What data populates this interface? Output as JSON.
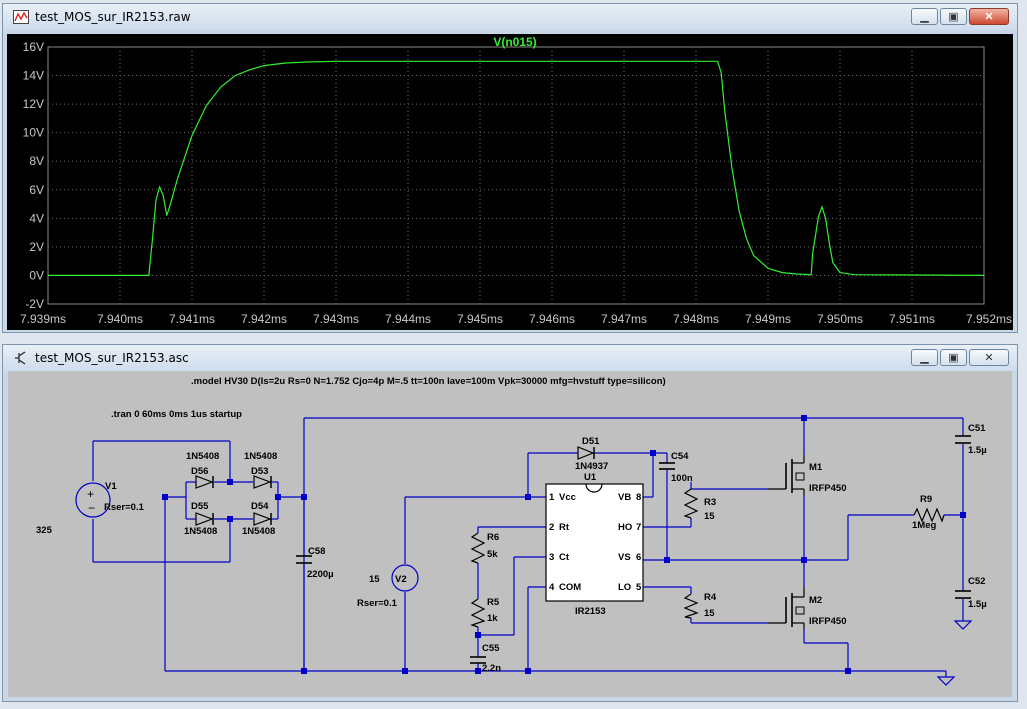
{
  "plot_window": {
    "title": "test_MOS_sur_IR2153.raw"
  },
  "schematic_window": {
    "title": "test_MOS_sur_IR2153.asc"
  },
  "chart_data": {
    "type": "line",
    "title": "V(n015)",
    "x_tick_labels": [
      "7.939ms",
      "7.940ms",
      "7.941ms",
      "7.942ms",
      "7.943ms",
      "7.944ms",
      "7.945ms",
      "7.946ms",
      "7.947ms",
      "7.948ms",
      "7.949ms",
      "7.950ms",
      "7.951ms",
      "7.952ms"
    ],
    "y_tick_labels": [
      "16V",
      "14V",
      "12V",
      "10V",
      "8V",
      "6V",
      "4V",
      "2V",
      "0V",
      "-2V"
    ],
    "xlim": [
      7.939,
      7.952
    ],
    "ylim": [
      -2,
      16
    ],
    "x_unit": "ms",
    "grid": true,
    "series": [
      {
        "name": "V(n015)",
        "color": "#33ee33",
        "x": [
          7.939,
          7.9404,
          7.94045,
          7.9405,
          7.94055,
          7.9406,
          7.94065,
          7.9407,
          7.9408,
          7.941,
          7.9412,
          7.9414,
          7.9416,
          7.9418,
          7.942,
          7.9423,
          7.9426,
          7.943,
          7.948,
          7.9483,
          7.94835,
          7.9484,
          7.9485,
          7.9486,
          7.9487,
          7.9488,
          7.949,
          7.9492,
          7.9494,
          7.9496,
          7.94962,
          7.9497,
          7.94975,
          7.9498,
          7.94985,
          7.9499,
          7.95,
          7.9502,
          7.952
        ],
        "y": [
          0,
          0,
          2.5,
          5.3,
          6.2,
          5.6,
          4.2,
          5.0,
          6.8,
          9.8,
          11.9,
          13.2,
          14.0,
          14.4,
          14.7,
          14.88,
          14.95,
          15.0,
          15.0,
          15.0,
          14.2,
          11.5,
          7.5,
          4.5,
          2.6,
          1.4,
          0.5,
          0.2,
          0.1,
          0.05,
          1.5,
          4.1,
          4.8,
          4.0,
          2.3,
          0.9,
          0.2,
          0.05,
          0
        ]
      }
    ]
  },
  "schematic": {
    "model_directive": ".model HV30 D(Is=2u Rs=0 N=1.752 Cjo=4p M=.5 tt=100n Iave=100m Vpk=30000 mfg=hvstuff type=silicon)",
    "tran_directive": ".tran 0 60ms 0ms 1us startup",
    "V1": {
      "name": "V1",
      "value": "325",
      "series_r": "Rser=0.1"
    },
    "V2": {
      "name": "V2",
      "value": "15",
      "series_r": "Rser=0.1"
    },
    "D56": {
      "name": "D56",
      "model": "1N5408"
    },
    "D53": {
      "name": "D53",
      "model": "1N5408"
    },
    "D55": {
      "name": "D55",
      "model": "1N5408"
    },
    "D54": {
      "name": "D54",
      "model": "1N5408"
    },
    "D51": {
      "name": "D51",
      "model": "1N4937"
    },
    "C58": {
      "name": "C58",
      "value": "2200µ"
    },
    "C54": {
      "name": "C54",
      "value": "100n"
    },
    "C55": {
      "name": "C55",
      "value": "2.2n"
    },
    "C51": {
      "name": "C51",
      "value": "1.5µ"
    },
    "C52": {
      "name": "C52",
      "value": "1.5µ"
    },
    "R6": {
      "name": "R6",
      "value": "5k"
    },
    "R5": {
      "name": "R5",
      "value": "1k"
    },
    "R3": {
      "name": "R3",
      "value": "15"
    },
    "R4": {
      "name": "R4",
      "value": "15"
    },
    "R9": {
      "name": "R9",
      "value": "1Meg"
    },
    "M1": {
      "name": "M1",
      "model": "IRFP450"
    },
    "M2": {
      "name": "M2",
      "model": "IRFP450"
    },
    "U1": {
      "name": "U1",
      "part": "IR2153",
      "pins": {
        "p1": "1",
        "vcc": "Vcc",
        "p2": "2",
        "rt": "Rt",
        "p3": "3",
        "ct": "Ct",
        "p4": "4",
        "com": "COM",
        "vb": "VB",
        "p8": "8",
        "ho": "HO",
        "p7": "7",
        "vs": "VS",
        "p6": "6",
        "lo": "LO",
        "p5": "5"
      }
    }
  }
}
